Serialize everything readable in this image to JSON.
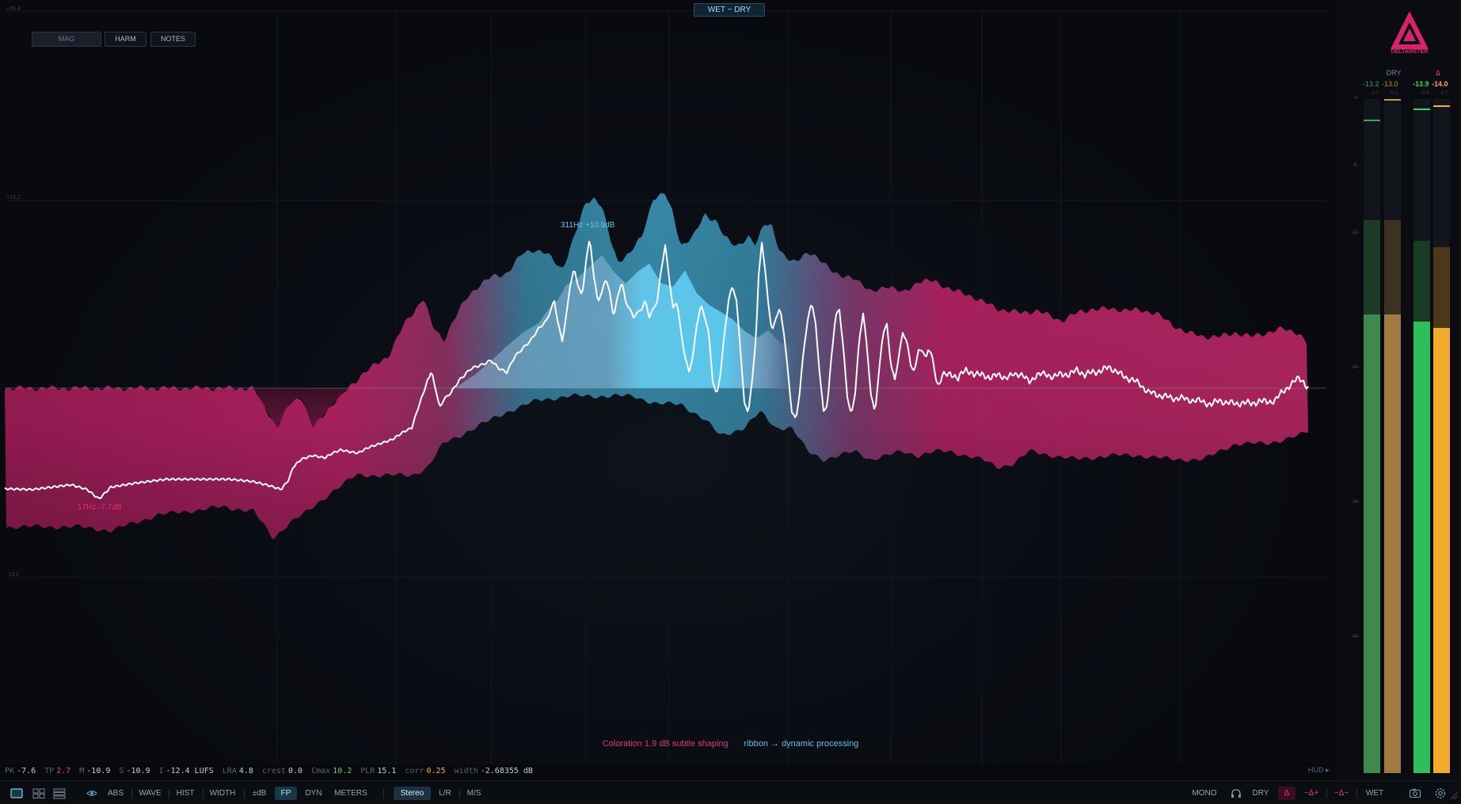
{
  "overlay_buttons": [
    {
      "label": "MAG",
      "active": true
    },
    {
      "label": "HARM",
      "active": false
    },
    {
      "label": "NOTES",
      "active": false
    }
  ],
  "wet_dry_button": "WET − DRY",
  "y_axis_labels": [
    "+26.4",
    "+13.2",
    "-13.2"
  ],
  "peak_labels": {
    "cyan": "311Hz +10.9dB",
    "pink": "17Hz -7.7dB"
  },
  "caption": {
    "coloration": "Coloration 1.9 dB  subtle shaping",
    "separator": "·",
    "ribbon": "ribbon → dynamic processing"
  },
  "stats": [
    {
      "key": "PK",
      "value": "-7.6",
      "color": "#c7ced8"
    },
    {
      "key": "TP",
      "value": "2.7",
      "color": "#e23b7c"
    },
    {
      "key": "M",
      "value": "-10.9",
      "color": "#c7ced8"
    },
    {
      "key": "S",
      "value": "-10.9",
      "color": "#c7ced8"
    },
    {
      "key": "I",
      "value": "-12.4 LUFS",
      "color": "#c7ced8"
    },
    {
      "key": "LRA",
      "value": "4.8",
      "color": "#c7ced8"
    },
    {
      "key": "crest",
      "value": "0.0",
      "color": "#c7ced8"
    },
    {
      "key": "Cmax",
      "value": "10.2",
      "color": "#5fd07a"
    },
    {
      "key": "PLR",
      "value": "15.1",
      "color": "#c7ced8"
    },
    {
      "key": "corr",
      "value": "0.25",
      "color": "#f2a93b"
    },
    {
      "key": "width",
      "value": "-2.68355 dB",
      "color": "#c7ced8"
    }
  ],
  "hud_label": "HUD ▸",
  "toolbar": {
    "layout_icons": [
      "single-view-icon",
      "grid-view-icon",
      "list-view-icon"
    ],
    "eye_icon": "eye-icon",
    "abs": "ABS",
    "wave": "WAVE",
    "hist": "HIST",
    "width": "WIDTH",
    "db": "±dB",
    "fp": "FP",
    "dyn": "DYN",
    "meters": "METERS",
    "stereo": "Stereo",
    "lr": "L/R",
    "ms": "M/S",
    "mono": "MONO",
    "headphones_icon": "headphones-icon",
    "dry": "DRY",
    "delta": "Δ",
    "delta_plus": "−Δ+",
    "delta_minus": "−Δ−",
    "wet": "WET",
    "camera_icon": "camera-icon",
    "settings_icon": "settings-icon"
  },
  "meters": {
    "logo_text": "DELTAMETER",
    "dry_label": "DRY",
    "delta_label": "Δ",
    "dry_values": [
      "-13.2",
      "-13.0"
    ],
    "delta_values": [
      "-13.9",
      "-14.0"
    ],
    "dry_peaks": [
      "-2.1",
      "-0.1"
    ],
    "delta_peaks": [
      "-0.9",
      "-0.7"
    ],
    "scale": [
      "0-",
      "-6-",
      "-12-",
      "-24-",
      "-36-",
      "-48-"
    ],
    "levels": [
      {
        "channel": "DRY L",
        "level_fraction": 0.68,
        "ghost_fraction": 0.82,
        "color": "#3d8a4c"
      },
      {
        "channel": "DRY R",
        "level_fraction": 0.68,
        "ghost_fraction": 0.82,
        "color": "#a07a41"
      },
      {
        "channel": "DELTA L",
        "level_fraction": 0.67,
        "ghost_fraction": 0.79,
        "color": "#2fbf5a"
      },
      {
        "channel": "DELTA R",
        "level_fraction": 0.66,
        "ghost_fraction": 0.78,
        "color": "#f0aa2c"
      }
    ],
    "colors": {
      "dry_value": "#3fa05a",
      "dry_value_r": "#c7862e",
      "delta_value": "#3fd06a",
      "delta_value_r": "#f4b13b"
    }
  }
}
